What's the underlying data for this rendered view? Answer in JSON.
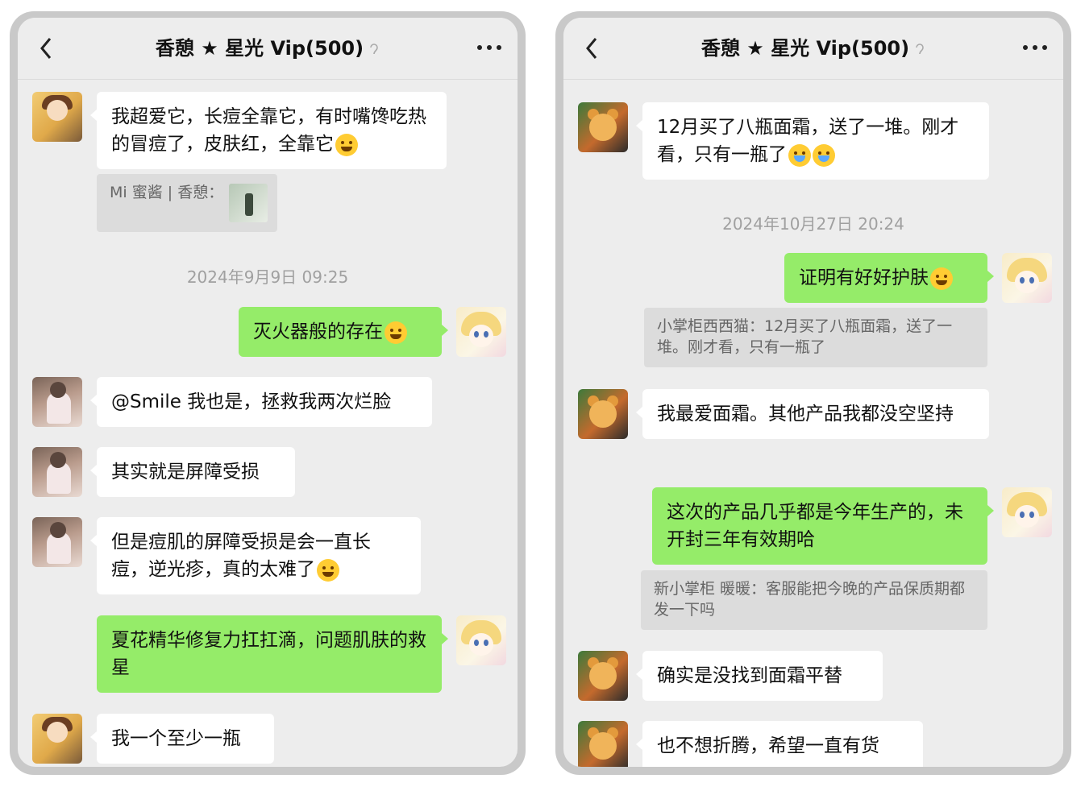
{
  "left": {
    "title": "香憩 ★ 星光 Vip(500)",
    "messages": {
      "m1": "我超爱它，长痘全靠它，有时嘴馋吃热的冒痘了，皮肤红，全靠它",
      "q1": "Mi 蜜酱 | 香憩：",
      "t1": "2024年9月9日 09:25",
      "m2": "灭火器般的存在",
      "m3": "@Smile 我也是，拯救我两次烂脸",
      "m4": "其实就是屏障受损",
      "m5": "但是痘肌的屏障受损是会一直长痘，逆光疹，真的太难了",
      "m6": "夏花精华修复力扛扛滴，问题肌肤的救星",
      "m7": "我一个至少一瓶"
    }
  },
  "right": {
    "title": "香憩 ★ 星光 Vip(500)",
    "messages": {
      "m1": "12月买了八瓶面霜，送了一堆。刚才看，只有一瓶了",
      "t1": "2024年10月27日 20:24",
      "m2": "证明有好好护肤",
      "q1": "小掌柜西西猫：12月买了八瓶面霜，送了一堆。刚才看，只有一瓶了",
      "m3": "我最爱面霜。其他产品我都没空坚持",
      "m4": "这次的产品几乎都是今年生产的，未开封三年有效期哈",
      "q2": "新小掌柜 暖暖：客服能把今晚的产品保质期都发一下吗",
      "m5": "确实是没找到面霜平替",
      "m6": "也不想折腾，希望一直有货"
    }
  },
  "colors": {
    "outgoing_bubble": "#95ec69",
    "incoming_bubble": "#ffffff",
    "chat_bg": "#ededed"
  },
  "icons": {
    "back": "chevron-left-icon",
    "more": "more-dots-icon",
    "ear": "earpiece-icon"
  }
}
